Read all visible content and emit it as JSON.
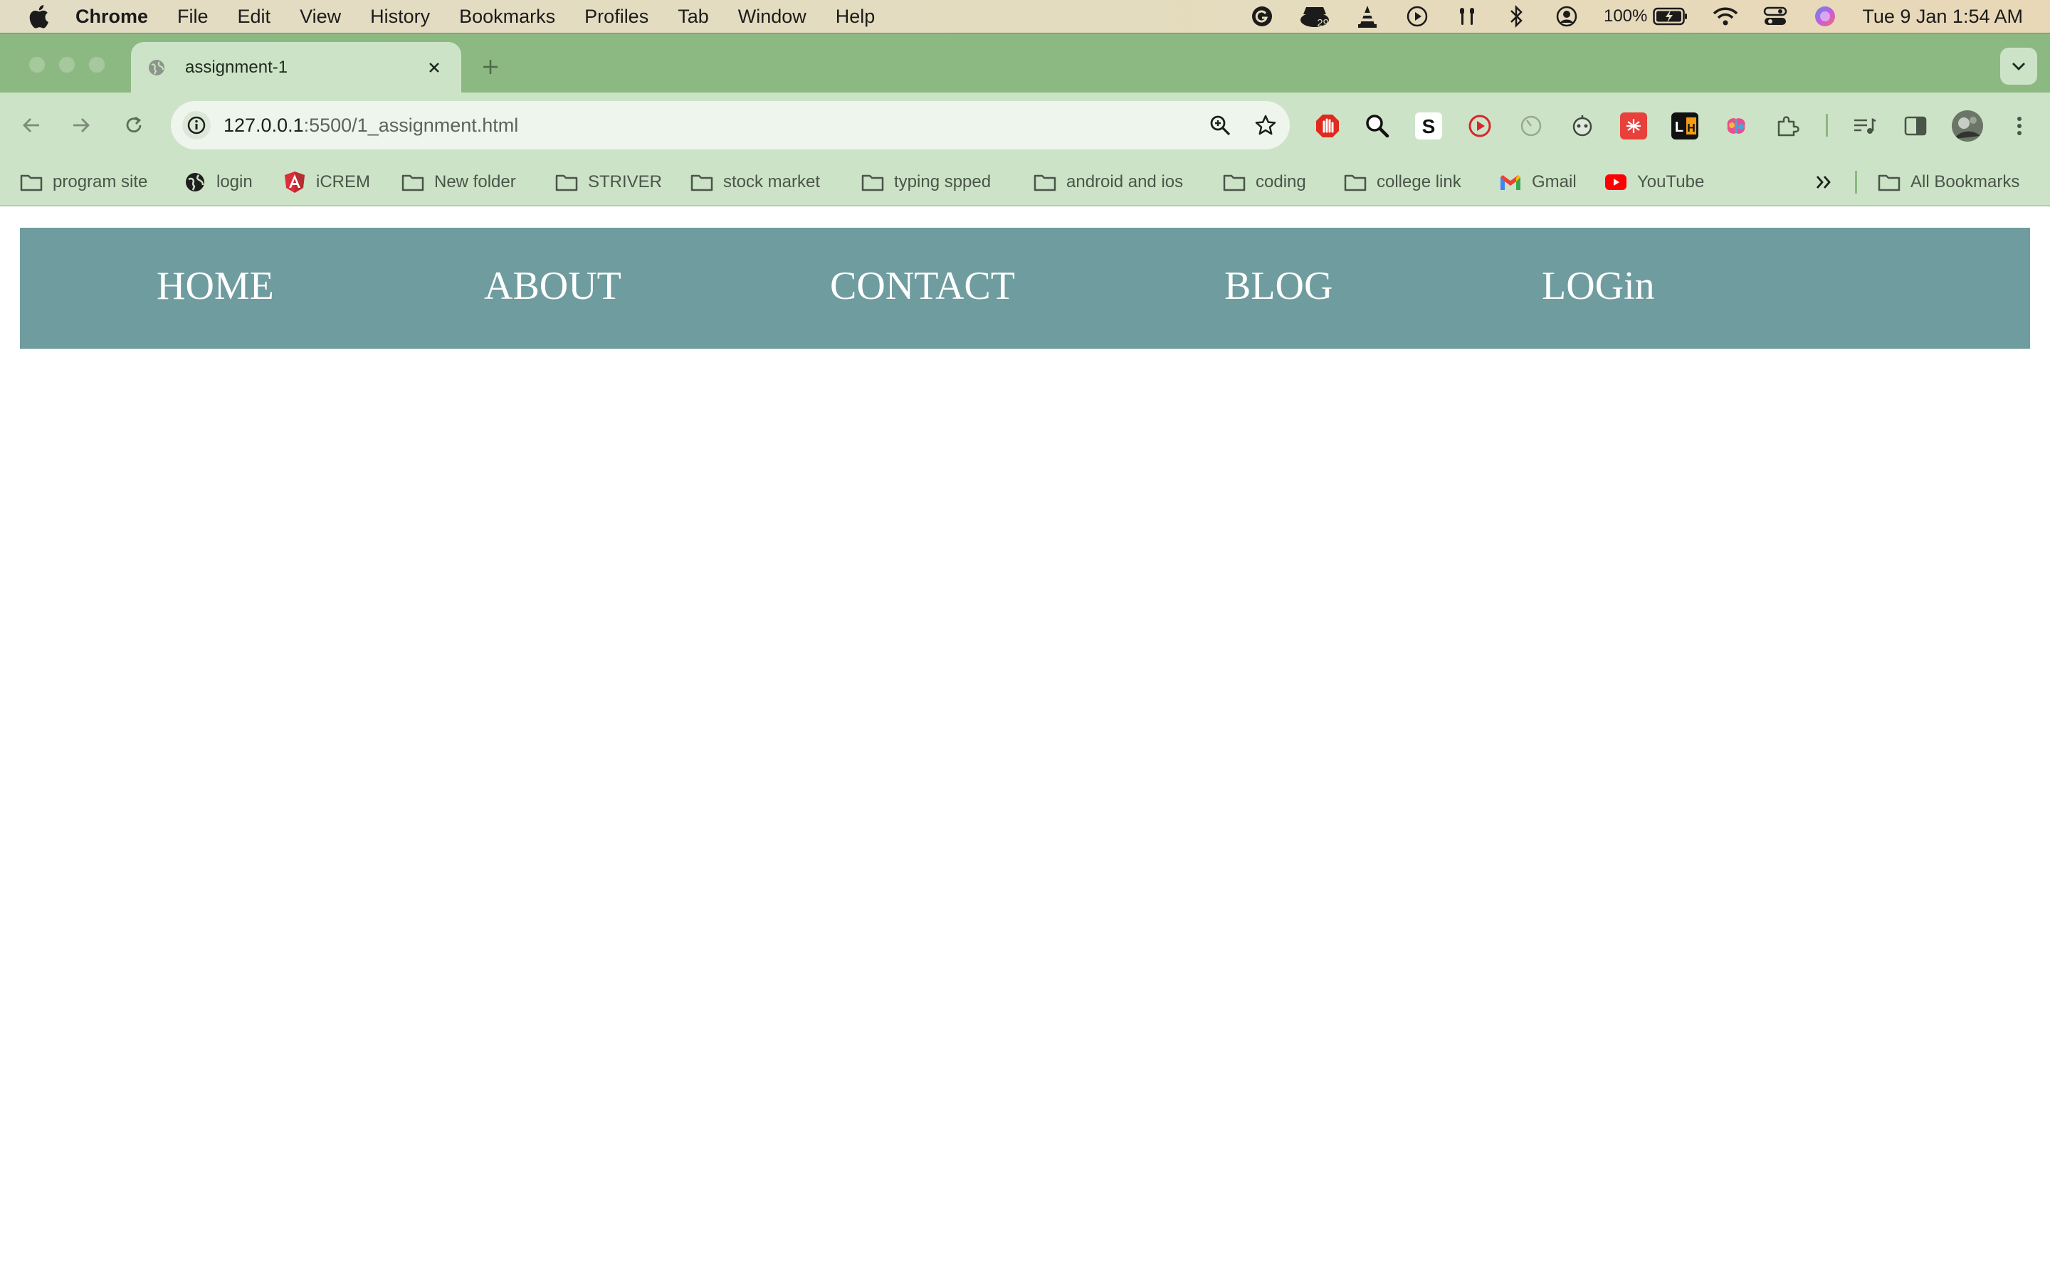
{
  "menubar": {
    "app_name": "Chrome",
    "items": [
      "File",
      "Edit",
      "View",
      "History",
      "Bookmarks",
      "Profiles",
      "Tab",
      "Window",
      "Help"
    ],
    "badge_count": "29",
    "battery": "100%",
    "clock": "Tue 9 Jan  1:54 AM"
  },
  "tab": {
    "title": "assignment-1"
  },
  "omnibox": {
    "host": "127.0.0.1",
    "path": ":5500/1_assignment.html"
  },
  "bookmarks": {
    "items": [
      "program site",
      "login",
      "iCREM",
      "New folder",
      "STRIVER",
      "stock market",
      "typing spped",
      "android and ios",
      "coding",
      "college link",
      "Gmail",
      "YouTube"
    ],
    "all_label": "All Bookmarks"
  },
  "site_nav": {
    "links": [
      "HOME",
      "ABOUT",
      "CONTACT",
      "BLOG",
      "LOGin"
    ],
    "background": "#6f9c9f"
  }
}
